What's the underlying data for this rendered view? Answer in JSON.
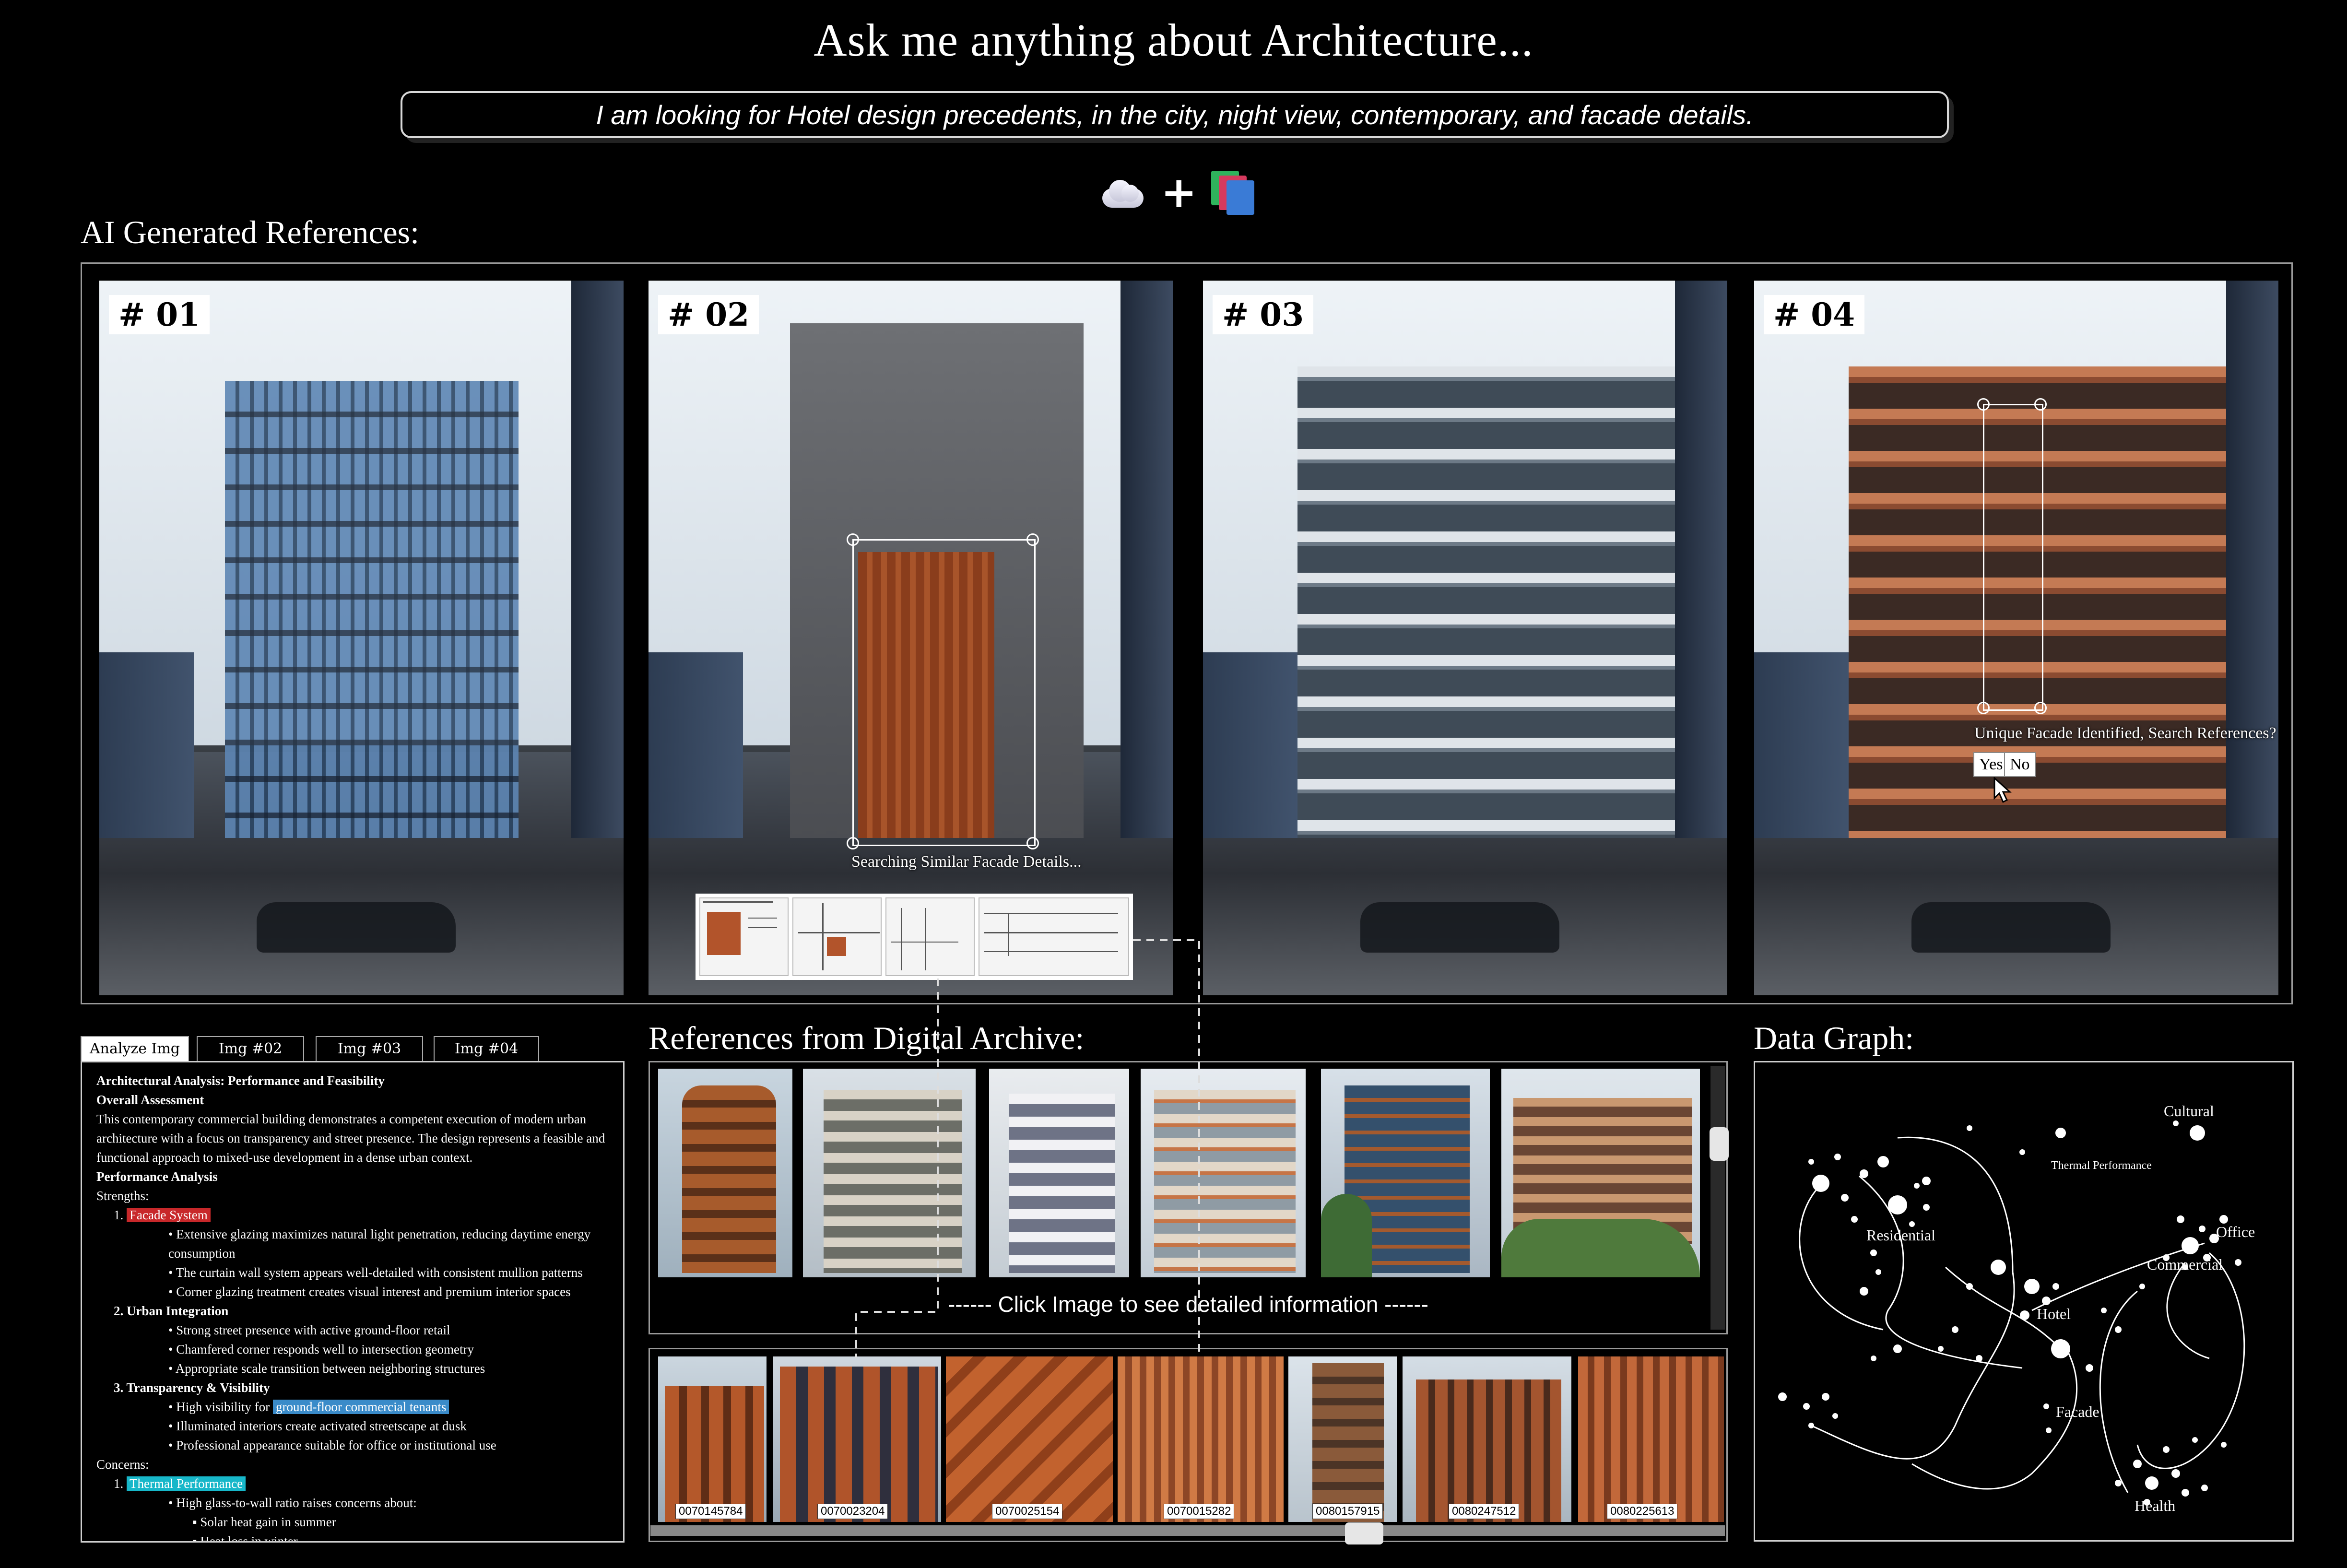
{
  "header": {
    "title": "Ask me anything about Architecture...",
    "query": "I am looking for Hotel design precedents, in the city, night view, contemporary, and facade details."
  },
  "tools": {
    "cloud_icon": "cloud-icon",
    "plus": "+",
    "books_icon": "stacked-books-icon"
  },
  "generated": {
    "heading": "AI Generated References:",
    "images": [
      {
        "label": "# 01"
      },
      {
        "label": "# 02"
      },
      {
        "label": "# 03"
      },
      {
        "label": "# 04"
      }
    ],
    "img02_status": "Searching Similar Facade Details...",
    "img04_prompt": "Unique Facade Identified, Search References?",
    "yes_label": "Yes",
    "no_label": "No"
  },
  "analysis": {
    "tabs": [
      "Analyze Img #01",
      "Img #02",
      "Img #03",
      "Img #04"
    ],
    "active_tab": 0,
    "title": "Architectural Analysis: Performance and Feasibility",
    "overall_heading": "Overall Assessment",
    "overall_text": "This contemporary commercial building demonstrates a competent execution of modern urban architecture with a focus on transparency and street presence. The design represents a feasible and functional approach to mixed-use development in a dense urban context.",
    "performance_heading": "Performance Analysis",
    "strengths_label": "Strengths:",
    "s1_num": "1.",
    "s1_title": "Facade System",
    "s1_items": [
      "Extensive glazing maximizes natural light penetration, reducing daytime energy consumption",
      "The curtain wall system appears well-detailed with consistent mullion patterns",
      "Corner glazing treatment creates visual interest and premium interior spaces"
    ],
    "s2_num": "2.",
    "s2_title": "Urban Integration",
    "s2_items": [
      "Strong street presence with active ground-floor retail",
      "Chamfered corner responds well to intersection geometry",
      "Appropriate scale transition between neighboring structures"
    ],
    "s3_num": "3.",
    "s3_title": "Transparency & Visibility",
    "s3_item1_prefix": "High visibility for ",
    "s3_item1_highlight": "ground-floor commercial tenants",
    "s3_items_rest": [
      "Illuminated interiors create activated streetscape at dusk",
      "Professional appearance suitable for office or institutional use"
    ],
    "concerns_label": "Concerns:",
    "c1_num": "1.",
    "c1_title": "Thermal Performance",
    "c1_item": "High glass-to-wall ratio raises concerns about:",
    "c1_sub": [
      "Solar heat gain in summer",
      "Heat loss in winter"
    ]
  },
  "references": {
    "heading": "References from Digital Archive:",
    "caption": "------ Click Image to see detailed information ------",
    "thumb_count": 6
  },
  "archive": {
    "ids": [
      "0070145784",
      "0070023204",
      "0070025154",
      "0070015282",
      "0080157915",
      "0080247512",
      "0080225613"
    ]
  },
  "graph": {
    "heading": "Data Graph:",
    "labels": {
      "cultural": "Cultural",
      "thermal": "Thermal Performance",
      "residential": "Residential",
      "office": "Office",
      "commercial": "Commercial",
      "hotel": "Hotel",
      "facade": "Facade",
      "health": "Health"
    }
  },
  "colors": {
    "background": "#000000",
    "highlight_red": "#c8282a",
    "highlight_blue": "#3a8bc9",
    "highlight_cyan": "#17b7c9",
    "terracotta": "#a8542a"
  }
}
